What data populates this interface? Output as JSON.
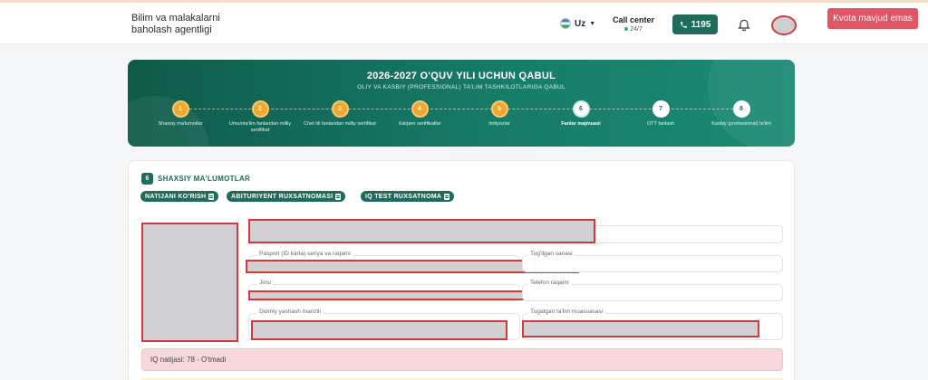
{
  "header": {
    "org_name": "Bilim va malakalarni baholash agentligi",
    "lang_code": "Uz",
    "call_center_title": "Call center",
    "call_center_hours": "24/7",
    "phone_number": "1195",
    "kvota_button_label": "Kvota mavjud emas"
  },
  "banner": {
    "title": "2026-2027 O'QUV YILI UCHUN QABUL",
    "subtitle": "OLIY VA KASBIY (PROFESSIONAL) TA'LIM TASHKILOTLARIGA QABUL",
    "steps": [
      {
        "num": "1",
        "label": "Shaxsiy ma'lumotlar",
        "state": "done"
      },
      {
        "num": "2",
        "label": "Umumta'lim fanlaridan milliy sertifikat",
        "state": "done"
      },
      {
        "num": "3",
        "label": "Chet tili fanlaridan milliy sertifikat",
        "state": "done"
      },
      {
        "num": "4",
        "label": "Xalqaro sertifikatlar",
        "state": "done"
      },
      {
        "num": "5",
        "label": "Imtiyozlar",
        "state": "done"
      },
      {
        "num": "6",
        "label": "Fanlar majmuasi",
        "state": "current"
      },
      {
        "num": "7",
        "label": "OTT tanlash",
        "state": "todo"
      },
      {
        "num": "8",
        "label": "Kasbiy (professional) ta'lim",
        "state": "todo"
      }
    ]
  },
  "section": {
    "badge": "6",
    "title": "SHAXSIY MA'LUMOTLAR",
    "pills": [
      "NATIJANI KO'RISH",
      "ABITURIYENT RUXSATNOMASI",
      "IQ TEST RUXSATNOMA"
    ],
    "fields": {
      "passport_label": "Pasport (ID karta) seriya va raqami",
      "birth_label": "Tug'ilgan sanasi",
      "gender_label": "Jinsi",
      "phone_label": "Telefon raqami",
      "address_label": "Doimiy yashash manzili",
      "school_label": "Tugatgan ta'lim muassasasi"
    },
    "iq_result": "IQ natijasi: 78 - O'tmadi"
  },
  "colors": {
    "primary": "#1f6b5c",
    "step_done": "#f0a72e",
    "kvota": "#e25563",
    "iq_bg": "#f7d8db",
    "redaction_border": "#cf3a3a"
  }
}
